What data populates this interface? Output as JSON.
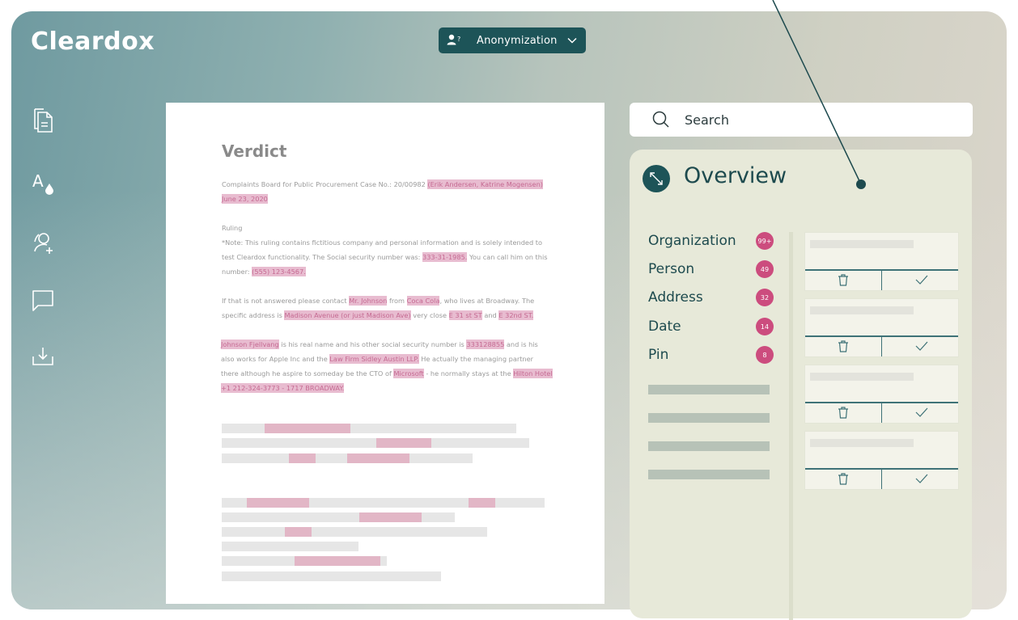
{
  "app": {
    "logo": "Cleardox"
  },
  "mode_dropdown": {
    "label": "Anonymization"
  },
  "sidebar": {
    "items": [
      "documents-icon",
      "style-icon",
      "users-icon",
      "comments-icon",
      "download-icon"
    ]
  },
  "document": {
    "title": "Verdict",
    "p1": {
      "t0": "Complaints Board for Public Procurement Case No.: 20/00982 ",
      "h0": "(Erik Andersen, Katrine Mogensen)",
      "t1": " ",
      "h1": "June 23, 2020"
    },
    "p2": {
      "t0": "Ruling"
    },
    "p3": {
      "t0": "*Note: This ruling contains fictitious company and personal information and is solely intended to test Cleardox functionality. The Social security number was: ",
      "h0": "333-31-1985.",
      "t1": " You can call him on this number: ",
      "h1": "(555) 123-4567."
    },
    "p4": {
      "t0": "If that is not answered please contact ",
      "h0": "Mr. Johnson",
      "t1": " from ",
      "h1": "Coca Cola",
      "t2": ", who lives at Broadway. The specific address is ",
      "h2": "Madison Avenue (or just Madison Ave)",
      "t3": " very close ",
      "h3": "E 31 st ST",
      "t4": " and ",
      "h4": "E 32nd ST."
    },
    "p5": {
      "h0": "Johnson Fjellvang",
      "t0": " is his real name and his other social security number is ",
      "h1": "333128855",
      "t1": " and is his also works for Apple Inc and the ",
      "h2": "Law Firm Sidley Austin LLP.",
      "t2": " He actually the managing partner there although he aspire to someday be the CTO of ",
      "h3": "Microsoft",
      "t3": " - he normally stays at the ",
      "h4": "Hilton Hotel +1 212-324-3773 - 1717 BROADWAY."
    }
  },
  "search": {
    "placeholder": "Search"
  },
  "overview": {
    "title": "Overview",
    "categories": [
      {
        "label": "Organization",
        "count": "99+"
      },
      {
        "label": "Person",
        "count": "49"
      },
      {
        "label": "Address",
        "count": "32"
      },
      {
        "label": "Date",
        "count": "14"
      },
      {
        "label": "Pin",
        "count": "8"
      }
    ]
  },
  "colors": {
    "accent": "#1d5458",
    "badge": "#cc4c7e",
    "highlight": "#e8bcd0",
    "panel": "#e7e9d9"
  }
}
